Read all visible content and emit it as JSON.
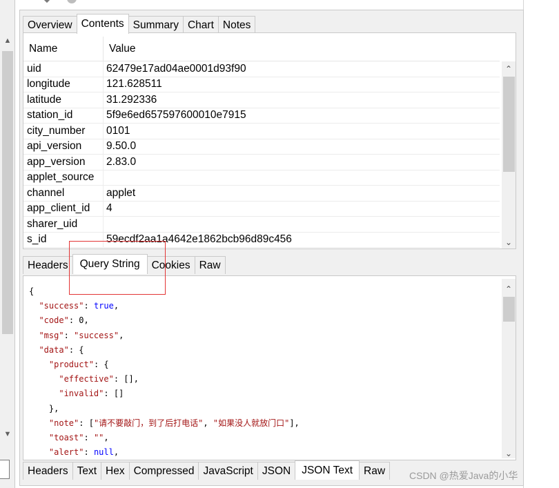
{
  "top_tabs": [
    "Overview",
    "Contents",
    "Summary",
    "Chart",
    "Notes"
  ],
  "top_active": "Contents",
  "grid": {
    "columns": [
      "Name",
      "Value"
    ],
    "rows": [
      {
        "name": "uid",
        "value": "62479e17ad04ae0001d93f90"
      },
      {
        "name": "longitude",
        "value": "121.628511"
      },
      {
        "name": "latitude",
        "value": "31.292336"
      },
      {
        "name": "station_id",
        "value": "5f9e6ed657597600010e7915"
      },
      {
        "name": "city_number",
        "value": "0101"
      },
      {
        "name": "api_version",
        "value": "9.50.0"
      },
      {
        "name": "app_version",
        "value": "2.83.0"
      },
      {
        "name": "applet_source",
        "value": ""
      },
      {
        "name": "channel",
        "value": "applet"
      },
      {
        "name": "app_client_id",
        "value": "4"
      },
      {
        "name": "sharer_uid",
        "value": ""
      },
      {
        "name": "s_id",
        "value": "59ecdf2aa1a4642e1862bcb96d89c456"
      }
    ]
  },
  "mid_tabs": [
    "Headers",
    "Query String",
    "Cookies",
    "Raw"
  ],
  "mid_active": "Query String",
  "json_text": {
    "lines": [
      "{",
      "  \"success\": true,",
      "  \"code\": 0,",
      "  \"msg\": \"success\",",
      "  \"data\": {",
      "    \"product\": {",
      "      \"effective\": [],",
      "      \"invalid\": []",
      "    },",
      "    \"note\": [\"请不要敲门，到了后打电话\", \"如果没人就放门口\"],",
      "    \"toast\": \"\",",
      "    \"alert\": null,"
    ]
  },
  "bottom_tabs": [
    "Headers",
    "Text",
    "Hex",
    "Compressed",
    "JavaScript",
    "JSON",
    "JSON Text",
    "Raw"
  ],
  "bottom_active": "JSON Text",
  "watermark": "CSDN @热爱Java的小华",
  "colors": {
    "highlight_box": "#e33434",
    "json_key": "#a31515",
    "json_literal": "#0000ff"
  },
  "icons": [
    "arrow-up-icon",
    "arrow-down-icon"
  ]
}
